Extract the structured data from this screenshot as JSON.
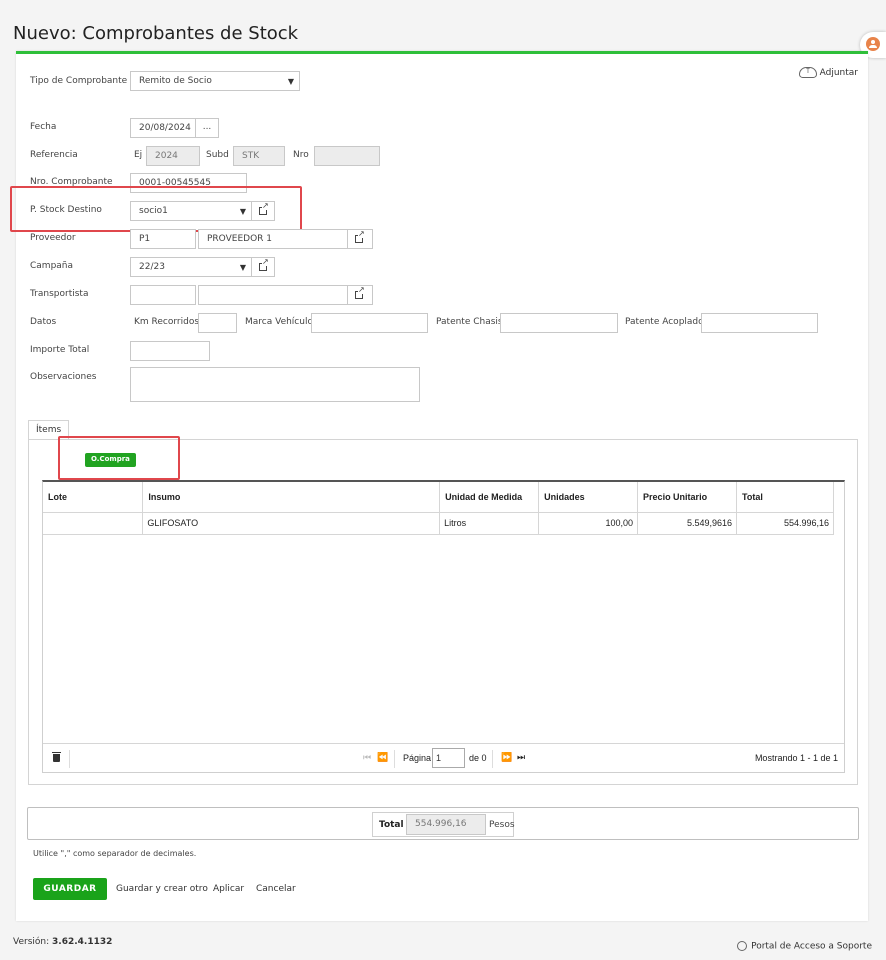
{
  "page": {
    "title": "Nuevo: Comprobantes de Stock"
  },
  "header": {
    "adjuntar_label": "Adjuntar"
  },
  "form": {
    "tipo_label": "Tipo de Comprobante",
    "tipo_value": "Remito de Socio",
    "fecha_label": "Fecha",
    "fecha_value": "20/08/2024",
    "fecha_btn": "...",
    "referencia_label": "Referencia",
    "ej_label": "Ej",
    "ej_value": "2024",
    "subd_label": "Subd",
    "subd_value": "STK",
    "nro_label": "Nro",
    "nro_value": "",
    "nro_comprobante_label": "Nro. Comprobante",
    "nro_comprobante_value": "0001-00545545",
    "stock_destino_label": "P. Stock Destino",
    "stock_destino_value": "socio1",
    "proveedor_label": "Proveedor",
    "proveedor_code": "P1",
    "proveedor_name": "PROVEEDOR 1",
    "campana_label": "Campaña",
    "campana_value": "22/23",
    "transportista_label": "Transportista",
    "transportista_code": "",
    "transportista_name": "",
    "datos_label": "Datos",
    "km_label": "Km Recorridos",
    "km_value": "",
    "marca_label": "Marca Vehículo",
    "marca_value": "",
    "patente_chasis_label": "Patente Chasis",
    "patente_chasis_value": "",
    "patente_acoplado_label": "Patente Acoplado",
    "patente_acoplado_value": "",
    "importe_label": "Importe Total",
    "importe_value": "",
    "observaciones_label": "Observaciones",
    "observaciones_value": ""
  },
  "tabs": [
    {
      "label": "Ítems"
    }
  ],
  "items": {
    "ocompra_label": "O.Compra",
    "columns": [
      "Lote",
      "Insumo",
      "Unidad de Medida",
      "Unidades",
      "Precio Unitario",
      "Total"
    ],
    "rows": [
      {
        "lote": "",
        "insumo": "GLIFOSATO",
        "unidad": "Litros",
        "unidades": "100,00",
        "precio": "5.549,9616",
        "total": "554.996,16"
      }
    ],
    "pager": {
      "pagina_label": "Página",
      "page_value": "1",
      "de_label": "de 0",
      "showing": "Mostrando 1 - 1 de 1"
    }
  },
  "totals": {
    "total_label": "Total",
    "total_value": "554.996,16",
    "currency": "Pesos"
  },
  "hint": "Utilice \",\" como separador de decimales.",
  "actions": {
    "guardar": "GUARDAR",
    "guardar_crear": "Guardar y crear otro",
    "aplicar": "Aplicar",
    "cancelar": "Cancelar"
  },
  "footer": {
    "version_label": "Versión:",
    "version_value": "3.62.4.1132",
    "support": "Portal de Acceso a Soporte"
  },
  "colors": {
    "accent_green": "#2fbf3a",
    "button_green": "#1aa31a",
    "highlight_red": "#e0474c"
  }
}
